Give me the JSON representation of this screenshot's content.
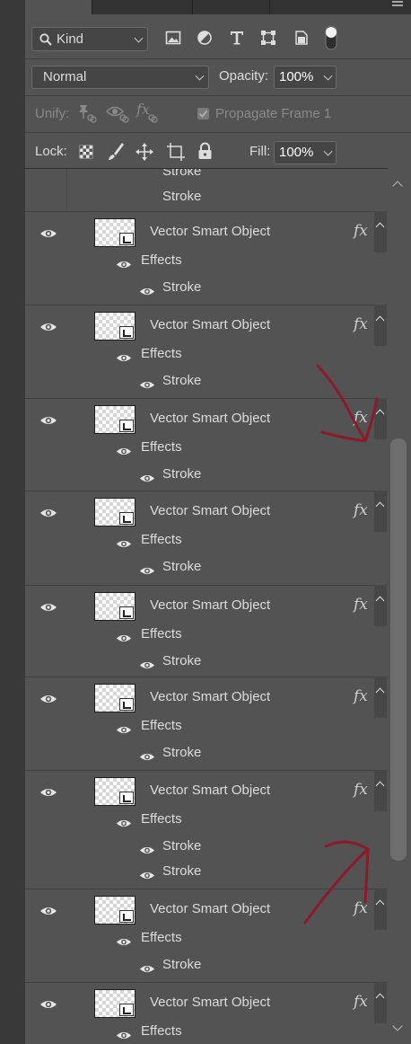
{
  "filter": {
    "kind_label": "Kind"
  },
  "blend": {
    "mode": "Normal",
    "opacity_label": "Opacity:",
    "opacity_value": "100%"
  },
  "unify": {
    "label": "Unify:",
    "propagate_label": "Propagate Frame 1"
  },
  "lock": {
    "label": "Lock:",
    "fill_label": "Fill:",
    "fill_value": "100%"
  },
  "layers": {
    "partial_top": {
      "stroke_a": "Stroke",
      "stroke_b": "Stroke"
    },
    "items": [
      {
        "name": "Vector Smart Object",
        "effects": "Effects",
        "strokes": [
          "Stroke"
        ]
      },
      {
        "name": "Vector Smart Object",
        "effects": "Effects",
        "strokes": [
          "Stroke"
        ]
      },
      {
        "name": "Vector Smart Object",
        "effects": "Effects",
        "strokes": [
          "Stroke"
        ]
      },
      {
        "name": "Vector Smart Object",
        "effects": "Effects",
        "strokes": [
          "Stroke"
        ]
      },
      {
        "name": "Vector Smart Object",
        "effects": "Effects",
        "strokes": [
          "Stroke"
        ]
      },
      {
        "name": "Vector Smart Object",
        "effects": "Effects",
        "strokes": [
          "Stroke"
        ]
      },
      {
        "name": "Vector Smart Object",
        "effects": "Effects",
        "strokes": [
          "Stroke",
          "Stroke"
        ]
      },
      {
        "name": "Vector Smart Object",
        "effects": "Effects",
        "strokes": [
          "Stroke"
        ]
      },
      {
        "name": "Vector Smart Object",
        "effects": "Effects",
        "strokes": []
      }
    ]
  },
  "icons": {
    "search": "search-icon",
    "image": "image-filter-icon",
    "adjust": "adjustment-filter-icon",
    "type": "type-filter-icon",
    "shape": "shape-filter-icon",
    "smart": "smart-object-filter-icon",
    "toggle": "filter-toggle-icon",
    "eye": "eye-icon",
    "fx": "fx-icon"
  },
  "colors": {
    "panel": "#535353",
    "annotation": "#8b1a2b"
  }
}
